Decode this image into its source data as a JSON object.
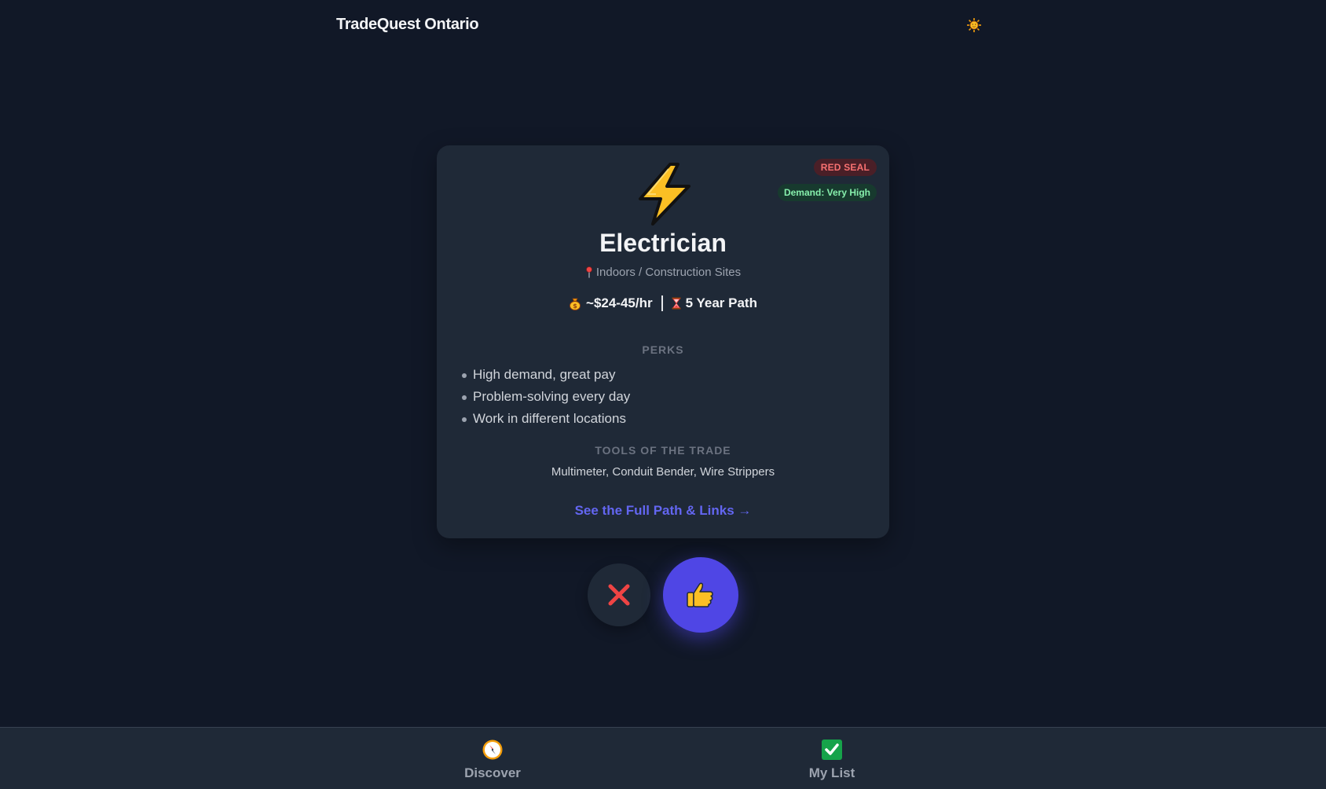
{
  "header": {
    "brand": "TradeQuest Ontario",
    "theme_icon": "sun-icon"
  },
  "card": {
    "badges": {
      "certification": "RED SEAL",
      "demand": "Demand: Very High"
    },
    "icon": "lightning-bolt-icon",
    "title": "Electrician",
    "location": "Indoors / Construction Sites",
    "pay": "~$24-45/hr",
    "path_length": "5 Year Path",
    "perks_heading": "PERKS",
    "perks": [
      "High demand, great pay",
      "Problem-solving every day",
      "Work in different locations"
    ],
    "tools_heading": "TOOLS OF THE TRADE",
    "tools": "Multimeter, Conduit Bender, Wire Strippers",
    "link": "See the Full Path & Links →"
  },
  "actions": {
    "dismiss_icon": "x-icon",
    "like_icon": "thumbs-up-icon"
  },
  "nav": {
    "items": [
      {
        "label": "Discover",
        "icon": "compass-icon"
      },
      {
        "label": "My List",
        "icon": "checkmark-icon"
      }
    ]
  },
  "colors": {
    "background": "#111827",
    "card": "#1f2937",
    "accent": "#4f46e5",
    "link": "#6366f1",
    "red_seal": "#f87171",
    "demand": "#86efac"
  }
}
